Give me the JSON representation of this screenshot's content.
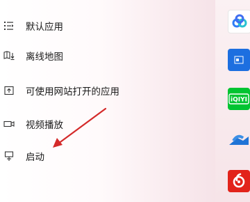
{
  "nav": {
    "items": [
      {
        "label": "默认应用",
        "icon": "list-icon"
      },
      {
        "label": "离线地图",
        "icon": "map-download-icon"
      },
      {
        "label": "可使用网站打开的应用",
        "icon": "web-open-icon"
      },
      {
        "label": "视频播放",
        "icon": "video-icon"
      },
      {
        "label": "启动",
        "icon": "startup-icon"
      }
    ]
  },
  "apps": [
    {
      "name": "baidu-netdisk-icon",
      "color": "#2f7cf6"
    },
    {
      "name": "app-blue-icon",
      "color": "#1d6fe0"
    },
    {
      "name": "iqiyi-icon",
      "color": "#00c431",
      "text": "iQIYI"
    },
    {
      "name": "onedrive-icon",
      "color": "#1f74d6"
    },
    {
      "name": "netease-music-icon",
      "color": "#e2231a"
    }
  ],
  "colors": {
    "annotation_arrow": "#d42a2a"
  }
}
